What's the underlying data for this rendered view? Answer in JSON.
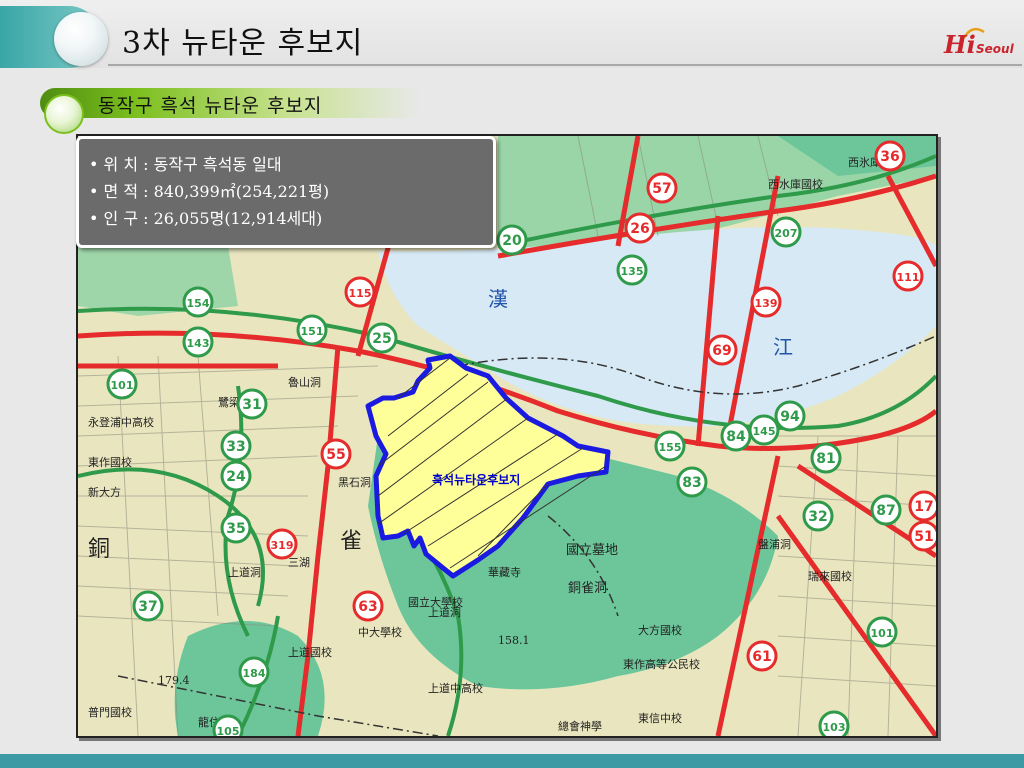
{
  "slide": {
    "title": "3차 뉴타운 후보지",
    "subtitle": "동작구 흑석 뉴타운 후보지",
    "logo": {
      "main": "Hi",
      "sub": "Seoul",
      "color": "#c9242b"
    }
  },
  "info": {
    "lines": [
      "• 위 치 : 동작구 흑석동 일대",
      "• 면 적 : 840,399㎡(254,221평)",
      "• 인 구 : 26,055명(12,914세대)"
    ]
  },
  "map": {
    "district_label": "흑석뉴타운후보지",
    "district_outline_color": "#1a1ae0",
    "river_labels": [
      "漢",
      "江"
    ],
    "place_labels": [
      "上道洞",
      "銅",
      "雀",
      "國立墓地",
      "銅雀洞",
      "東作高等公民校",
      "總會神學",
      "瑞來國校",
      "永登浦中高校",
      "鷺梁津",
      "國立大學校",
      "西水庫國校",
      "魯山洞",
      "東作國校",
      "華藏寺",
      "上道國校",
      "黑石洞",
      "普門國校",
      "大方國校",
      "盤浦洞",
      "上道中高校",
      "龍住寺",
      "東信中校",
      "西氷庫洞",
      "上道洞",
      "中大學校",
      "新大方",
      "三湖"
    ],
    "route_numbers": [
      "36",
      "57",
      "26",
      "207",
      "135",
      "115",
      "151",
      "25",
      "139",
      "69",
      "111",
      "101",
      "31",
      "33",
      "24",
      "55",
      "35",
      "319",
      "37",
      "63",
      "184",
      "61",
      "101",
      "103",
      "51",
      "87",
      "32",
      "94",
      "145",
      "84",
      "81",
      "83",
      "155",
      "154",
      "143",
      "20",
      "105",
      "17"
    ],
    "elevation_labels": [
      "158.1",
      "179.4"
    ],
    "colors": {
      "land": "#e9e6bf",
      "river": "#d6e9f5",
      "park": "#6cc69a",
      "road_major": "#e52b2b",
      "road_green": "#2e9a4a",
      "district_fill": "#ffff99"
    }
  }
}
